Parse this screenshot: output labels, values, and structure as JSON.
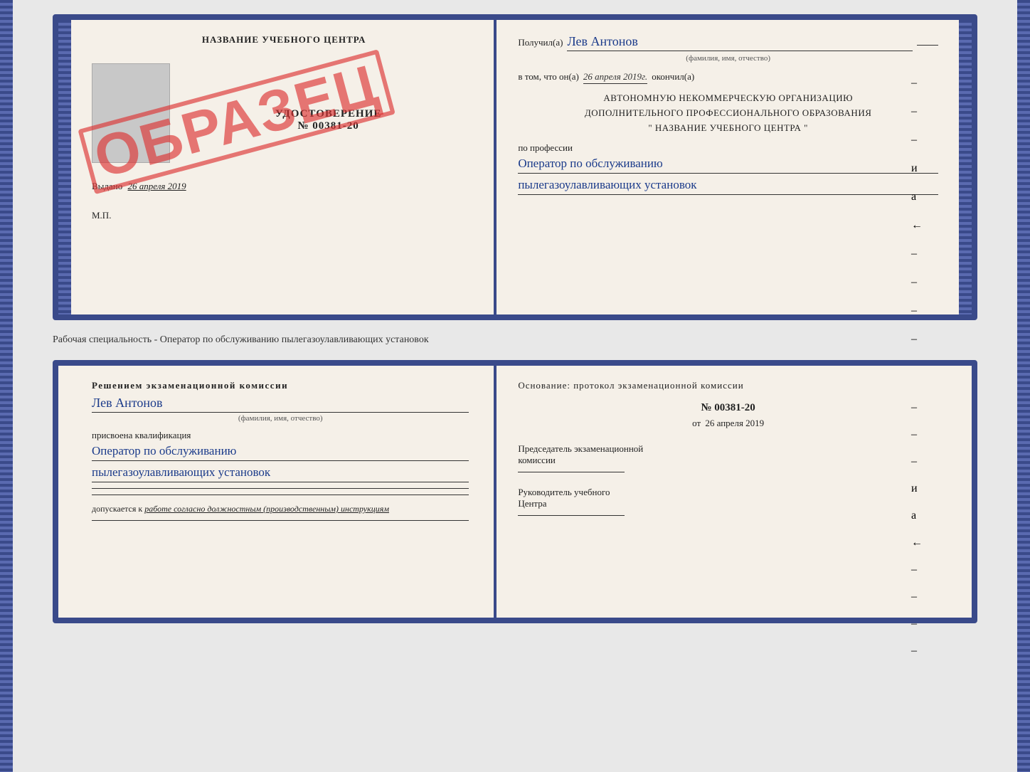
{
  "upper_left": {
    "school_title": "НАЗВАНИЕ УЧЕБНОГО ЦЕНТРА",
    "udostoverenie_label": "УДОСТОВЕРЕНИЕ",
    "udostoverenie_number": "№ 00381-20",
    "vydano": "Выдано",
    "vydano_date": "26 апреля 2019",
    "mp_label": "М.П.",
    "obrazec": "ОБРАЗЕЦ"
  },
  "upper_right": {
    "poluchil_label": "Получил(а)",
    "recipient_name": "Лев Антонов",
    "fio_label": "(фамилия, имя, отчество)",
    "vtom_label": "в том, что он(а)",
    "completion_date": "26 апреля 2019г.",
    "okonchil_label": "окончил(а)",
    "org_line1": "АВТОНОМНУЮ НЕКОММЕРЧЕСКУЮ ОРГАНИЗАЦИЮ",
    "org_line2": "ДОПОЛНИТЕЛЬНОГО ПРОФЕССИОНАЛЬНОГО ОБРАЗОВАНИЯ",
    "org_line3": "\"  НАЗВАНИЕ УЧЕБНОГО ЦЕНТРА  \"",
    "po_professii": "по профессии",
    "profession_line1": "Оператор по обслуживанию",
    "profession_line2": "пылегазоулавливающих установок"
  },
  "separator": {
    "text": "Рабочая специальность - Оператор по обслуживанию пылегазоулавливающих установок"
  },
  "lower_left": {
    "resheniem_label": "Решением экзаменационной комиссии",
    "recipient_name": "Лев Антонов",
    "fio_label": "(фамилия, имя, отчество)",
    "prisvoena": "присвоена квалификация",
    "qualification_line1": "Оператор по обслуживанию",
    "qualification_line2": "пылегазоулавливающих установок",
    "dopuskaetsya_prefix": "допускается к",
    "dopuskaetsya_italic": "работе согласно должностным (производственным) инструкциям"
  },
  "lower_right": {
    "osnovanie_label": "Основание: протокол экзаменационной комиссии",
    "protocol_number": "№ 00381-20",
    "ot_prefix": "от",
    "ot_date": "26 апреля 2019",
    "predsedatel_line1": "Председатель экзаменационной",
    "predsedatel_line2": "комиссии",
    "rukovoditel_line1": "Руководитель учебного",
    "rukovoditel_line2": "Центра"
  },
  "side_dashes": [
    "–",
    "–",
    "–",
    "и",
    "а",
    "←",
    "–",
    "–",
    "–",
    "–"
  ],
  "colors": {
    "border": "#3a4a8a",
    "handwriting": "#1a3a8a",
    "stamp": "rgba(220,50,50,0.65)",
    "bg": "#f5f0e8"
  }
}
